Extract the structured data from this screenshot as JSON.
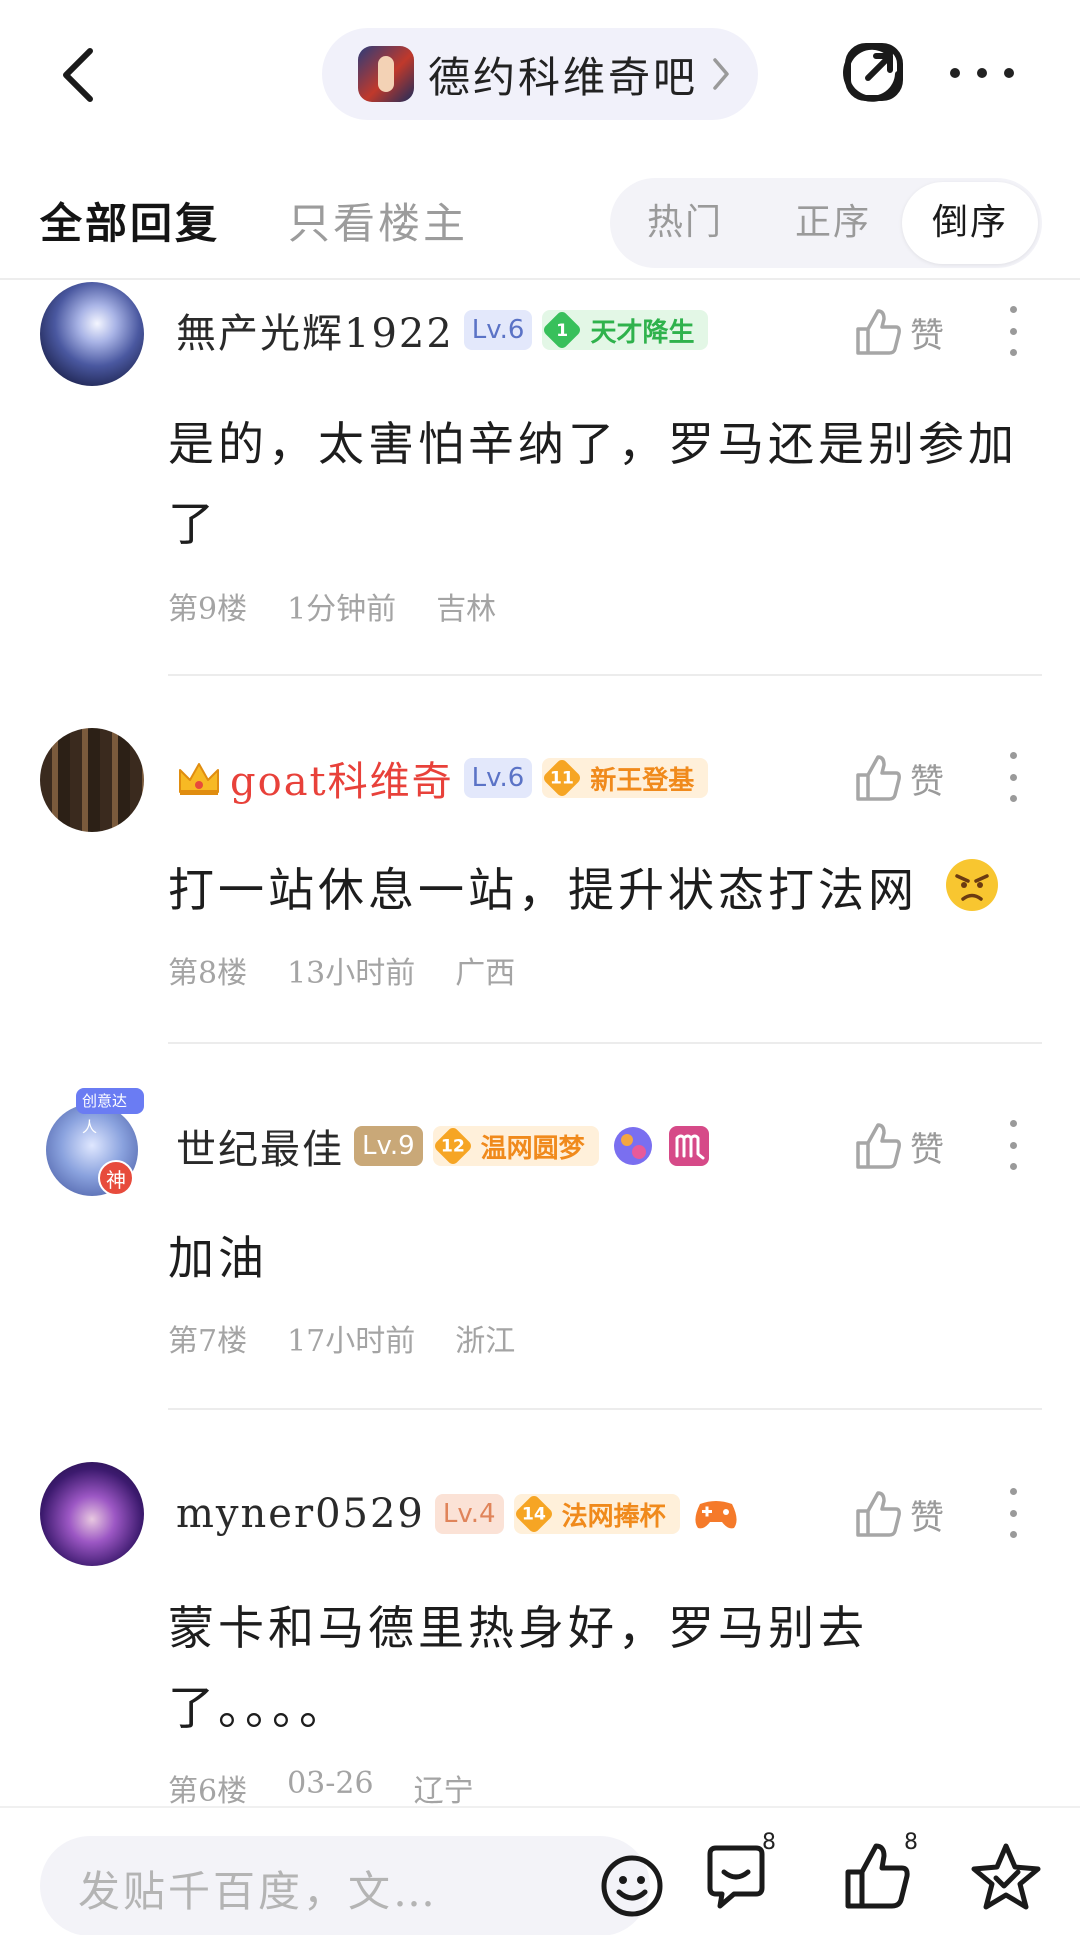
{
  "header": {
    "forum_name": "德约科维奇吧"
  },
  "tabs": {
    "all_replies": "全部回复",
    "only_op": "只看楼主",
    "sort_hot": "热门",
    "sort_asc": "正序",
    "sort_desc": "倒序",
    "selected_sort": "倒序"
  },
  "posts": [
    {
      "username": "無产光辉1922",
      "level": "Lv.6",
      "badge_num": "1",
      "badge_text": "天才降生",
      "like_label": "赞",
      "content": "是的，太害怕辛纳了，罗马还是别参加了",
      "floor": "第9楼",
      "time": "1分钟前",
      "location": "吉林"
    },
    {
      "username": "goat科维奇",
      "level": "Lv.6",
      "badge_num": "11",
      "badge_text": "新王登基",
      "like_label": "赞",
      "content": "打一站休息一站，提升状态打法网",
      "floor": "第8楼",
      "time": "13小时前",
      "location": "广西"
    },
    {
      "username": "世纪最佳",
      "level": "Lv.9",
      "badge_num": "12",
      "badge_text": "温网圆梦",
      "avatar_tag": "创意达人",
      "avatar_badge": "神",
      "like_label": "赞",
      "content": "加油",
      "floor": "第7楼",
      "time": "17小时前",
      "location": "浙江"
    },
    {
      "username": "myner0529",
      "level": "Lv.4",
      "badge_num": "14",
      "badge_text": "法网捧杯",
      "like_label": "赞",
      "content": "蒙卡和马德里热身好，罗马别去了。。。。",
      "floor": "第6楼",
      "time": "03-26",
      "location": "辽宁"
    }
  ],
  "bottom_bar": {
    "reply_placeholder": "发贴千百度，文…",
    "comment_count": "8",
    "like_count": "8"
  },
  "colors": {
    "accent_red": "#e8413a",
    "level_blue": "#5b73c6",
    "badge_green": "#2fb24c",
    "badge_orange": "#f08a1c"
  },
  "icons": [
    "back-arrow-icon",
    "chevron-right-icon",
    "share-icon",
    "more-icon",
    "thumbs-up-icon",
    "kebab-menu-icon",
    "crown-icon",
    "emoji-icon",
    "comment-icon",
    "star-icon"
  ]
}
